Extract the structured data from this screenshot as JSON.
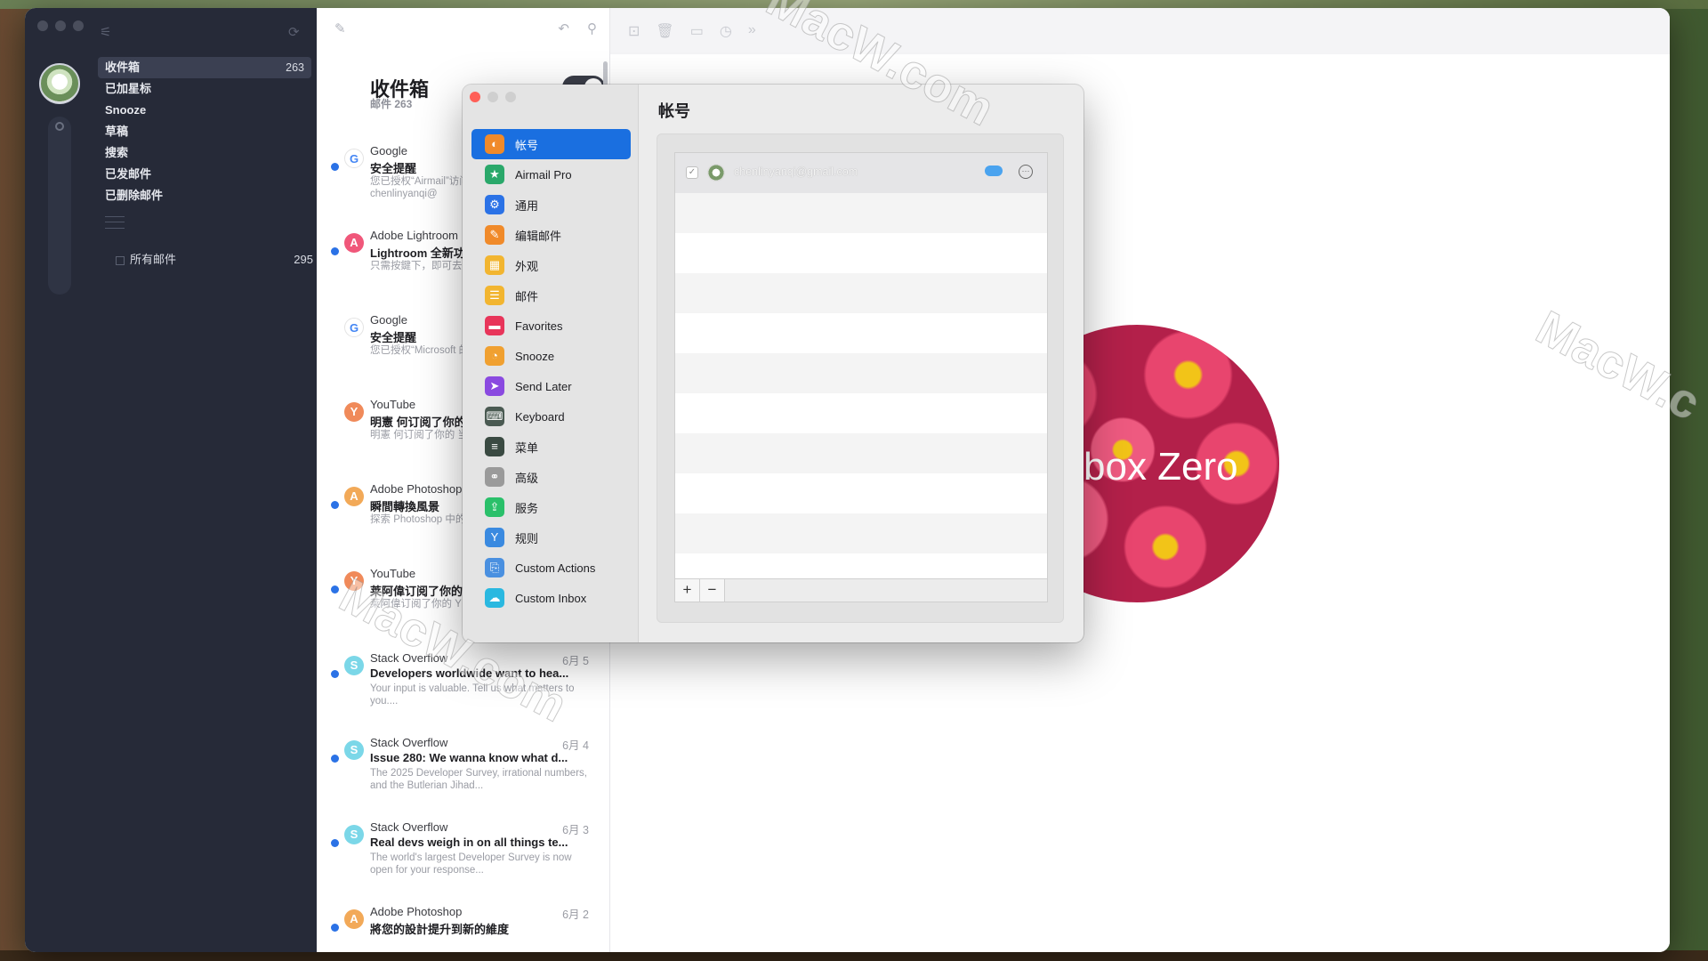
{
  "sidebar": {
    "folders": [
      {
        "label": "收件箱",
        "count": "263"
      },
      {
        "label": "已加星标",
        "count": ""
      },
      {
        "label": "Snooze",
        "count": ""
      },
      {
        "label": "草稿",
        "count": ""
      },
      {
        "label": "搜索",
        "count": ""
      },
      {
        "label": "已发邮件",
        "count": ""
      },
      {
        "label": "已删除邮件",
        "count": ""
      }
    ],
    "all_mail": {
      "label": "所有邮件",
      "count": "295"
    }
  },
  "message_list": {
    "title": "收件箱",
    "subtitle": "邮件 263",
    "messages": [
      {
        "from": "Google",
        "date": "",
        "subject": "安全提醒",
        "preview": "您已授权“Airmail”访问您的 Google 帐号数据 chenlinyanqi@",
        "icon": "G",
        "icon_color": "#ffffff",
        "unread": true
      },
      {
        "from": "Adobe Lightroom",
        "date": "",
        "subject": "Lightroom 全新功",
        "preview": "只需按鍵下，即可去除，按一下，就能去除在",
        "icon": "A",
        "icon_color": "#f0577a",
        "unread": true
      },
      {
        "from": "Google",
        "date": "",
        "subject": "安全提醒",
        "preview": "您已授权“Microsoft 的某些 Google 账号",
        "icon": "G",
        "icon_color": "#ffffff",
        "unread": false
      },
      {
        "from": "YouTube",
        "date": "",
        "subject": "明憲 何订阅了你的",
        "preview": "明憲 何订阅了你的 当你上传新视频或对",
        "icon": "Y",
        "icon_color": "#f08a5a",
        "unread": false
      },
      {
        "from": "Adobe Photoshop",
        "date": "",
        "subject": "瞬間轉換風景",
        "preview": "探索 Photoshop 中的各種可能性 適合所",
        "icon": "A",
        "icon_color": "#f2a958",
        "unread": true
      },
      {
        "from": "YouTube",
        "date": "",
        "subject": "莱阿偉订阅了你的",
        "preview": "莱阿偉订阅了你的 Y 当你上传新视频或对",
        "icon": "Y",
        "icon_color": "#f08a5a",
        "unread": true
      },
      {
        "from": "Stack Overflow",
        "date": "6月 5",
        "subject": "Developers worldwide want to hea...",
        "preview": "Your input is valuable. Tell us what matters to you....",
        "icon": "S",
        "icon_color": "#7bd7e8",
        "unread": true
      },
      {
        "from": "Stack Overflow",
        "date": "6月 4",
        "subject": "Issue 280: We wanna know what d...",
        "preview": "The 2025 Developer Survey, irrational numbers, and the Butlerian Jihad...",
        "icon": "S",
        "icon_color": "#7bd7e8",
        "unread": true
      },
      {
        "from": "Stack Overflow",
        "date": "6月 3",
        "subject": "Real devs weigh in on all things te...",
        "preview": "The world's largest Developer Survey is now open for your response...",
        "icon": "S",
        "icon_color": "#7bd7e8",
        "unread": true
      },
      {
        "from": "Adobe Photoshop",
        "date": "6月 2",
        "subject": "將您的設計提升到新的維度",
        "preview": "",
        "icon": "A",
        "icon_color": "#f2a958",
        "unread": true
      }
    ]
  },
  "reader": {
    "empty_state_text": "box Zero"
  },
  "prefs": {
    "title": "帐号",
    "items": [
      {
        "label": "帐号",
        "icon": "accounts-icon",
        "color": "#f08a2a",
        "glyph": "◐"
      },
      {
        "label": "Airmail Pro",
        "icon": "star-badge-icon",
        "color": "#2aa86a",
        "glyph": "★"
      },
      {
        "label": "通用",
        "icon": "gear-icon",
        "color": "#2b72e6",
        "glyph": "⚙"
      },
      {
        "label": "编辑邮件",
        "icon": "compose-icon",
        "color": "#f08a2a",
        "glyph": "✎"
      },
      {
        "label": "外观",
        "icon": "appearance-icon",
        "color": "#f2b530",
        "glyph": "▦"
      },
      {
        "label": "邮件",
        "icon": "mail-icon",
        "color": "#f2b530",
        "glyph": "☰"
      },
      {
        "label": "Favorites",
        "icon": "favorites-icon",
        "color": "#e8355a",
        "glyph": "▬"
      },
      {
        "label": "Snooze",
        "icon": "clock-icon",
        "color": "#f0a030",
        "glyph": "◔"
      },
      {
        "label": "Send Later",
        "icon": "paper-plane-icon",
        "color": "#8a4ae0",
        "glyph": "➤"
      },
      {
        "label": "Keyboard",
        "icon": "keyboard-icon",
        "color": "#4a5a52",
        "glyph": "⌨"
      },
      {
        "label": "菜单",
        "icon": "menu-icon",
        "color": "#3a4a42",
        "glyph": "≡"
      },
      {
        "label": "高级",
        "icon": "advanced-icon",
        "color": "#9a9a9a",
        "glyph": "⚭"
      },
      {
        "label": "服务",
        "icon": "services-icon",
        "color": "#2ac06a",
        "glyph": "⇪"
      },
      {
        "label": "规则",
        "icon": "rules-icon",
        "color": "#3a8ae0",
        "glyph": "Y"
      },
      {
        "label": "Custom Actions",
        "icon": "custom-actions-icon",
        "color": "#4a90e0",
        "glyph": "⎘"
      },
      {
        "label": "Custom Inbox",
        "icon": "custom-inbox-icon",
        "color": "#2ab8e0",
        "glyph": "☁"
      }
    ],
    "account": {
      "email": "chenlinyanqi@gmail.com",
      "checked_glyph": "✓",
      "more_glyph": "···"
    },
    "add_label": "+",
    "remove_label": "−"
  },
  "watermarks": [
    "MacW.com",
    "MacW.com",
    "MacW.c"
  ]
}
